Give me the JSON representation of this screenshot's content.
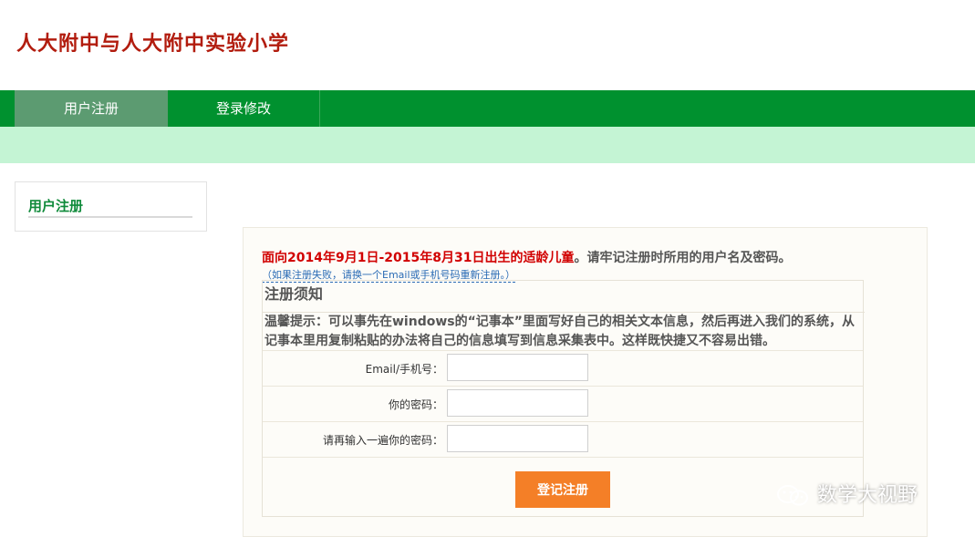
{
  "header": {
    "school_title": "人大附中与人大附中实验小学"
  },
  "nav": {
    "items": [
      {
        "label": "用户注册",
        "active": true
      },
      {
        "label": "登录修改",
        "active": false
      }
    ]
  },
  "sidebar": {
    "title": "用户注册"
  },
  "main": {
    "intro_red": "面向2014年9月1日-2015年8月31日出生的适龄儿童",
    "intro_rest": "。请牢记注册时所用的用户名及密码。",
    "retry_link": "（如果注册失败，请换一个Email或手机号码重新注册。）",
    "notice_title": "注册须知",
    "tip": "温馨提示：可以事先在windows的“记事本”里面写好自己的相关文本信息，然后再进入我们的系统，从记事本里用复制粘贴的办法将自己的信息填写到信息采集表中。这样既快捷又不容易出错。",
    "form": {
      "email_label": "Email/手机号：",
      "email_value": "",
      "password_label": "你的密码：",
      "password_value": "",
      "confirm_label": "请再输入一遍你的密码：",
      "confirm_value": "",
      "submit_label": "登记注册"
    }
  },
  "watermark": {
    "text": "数学大视野",
    "icon": "wechat-icon"
  },
  "colors": {
    "nav_bg": "#00912f",
    "nav_active": "#5c9b71",
    "subbar": "#c4f4d4",
    "title_red": "#b21c0e",
    "button": "#f47f27"
  }
}
